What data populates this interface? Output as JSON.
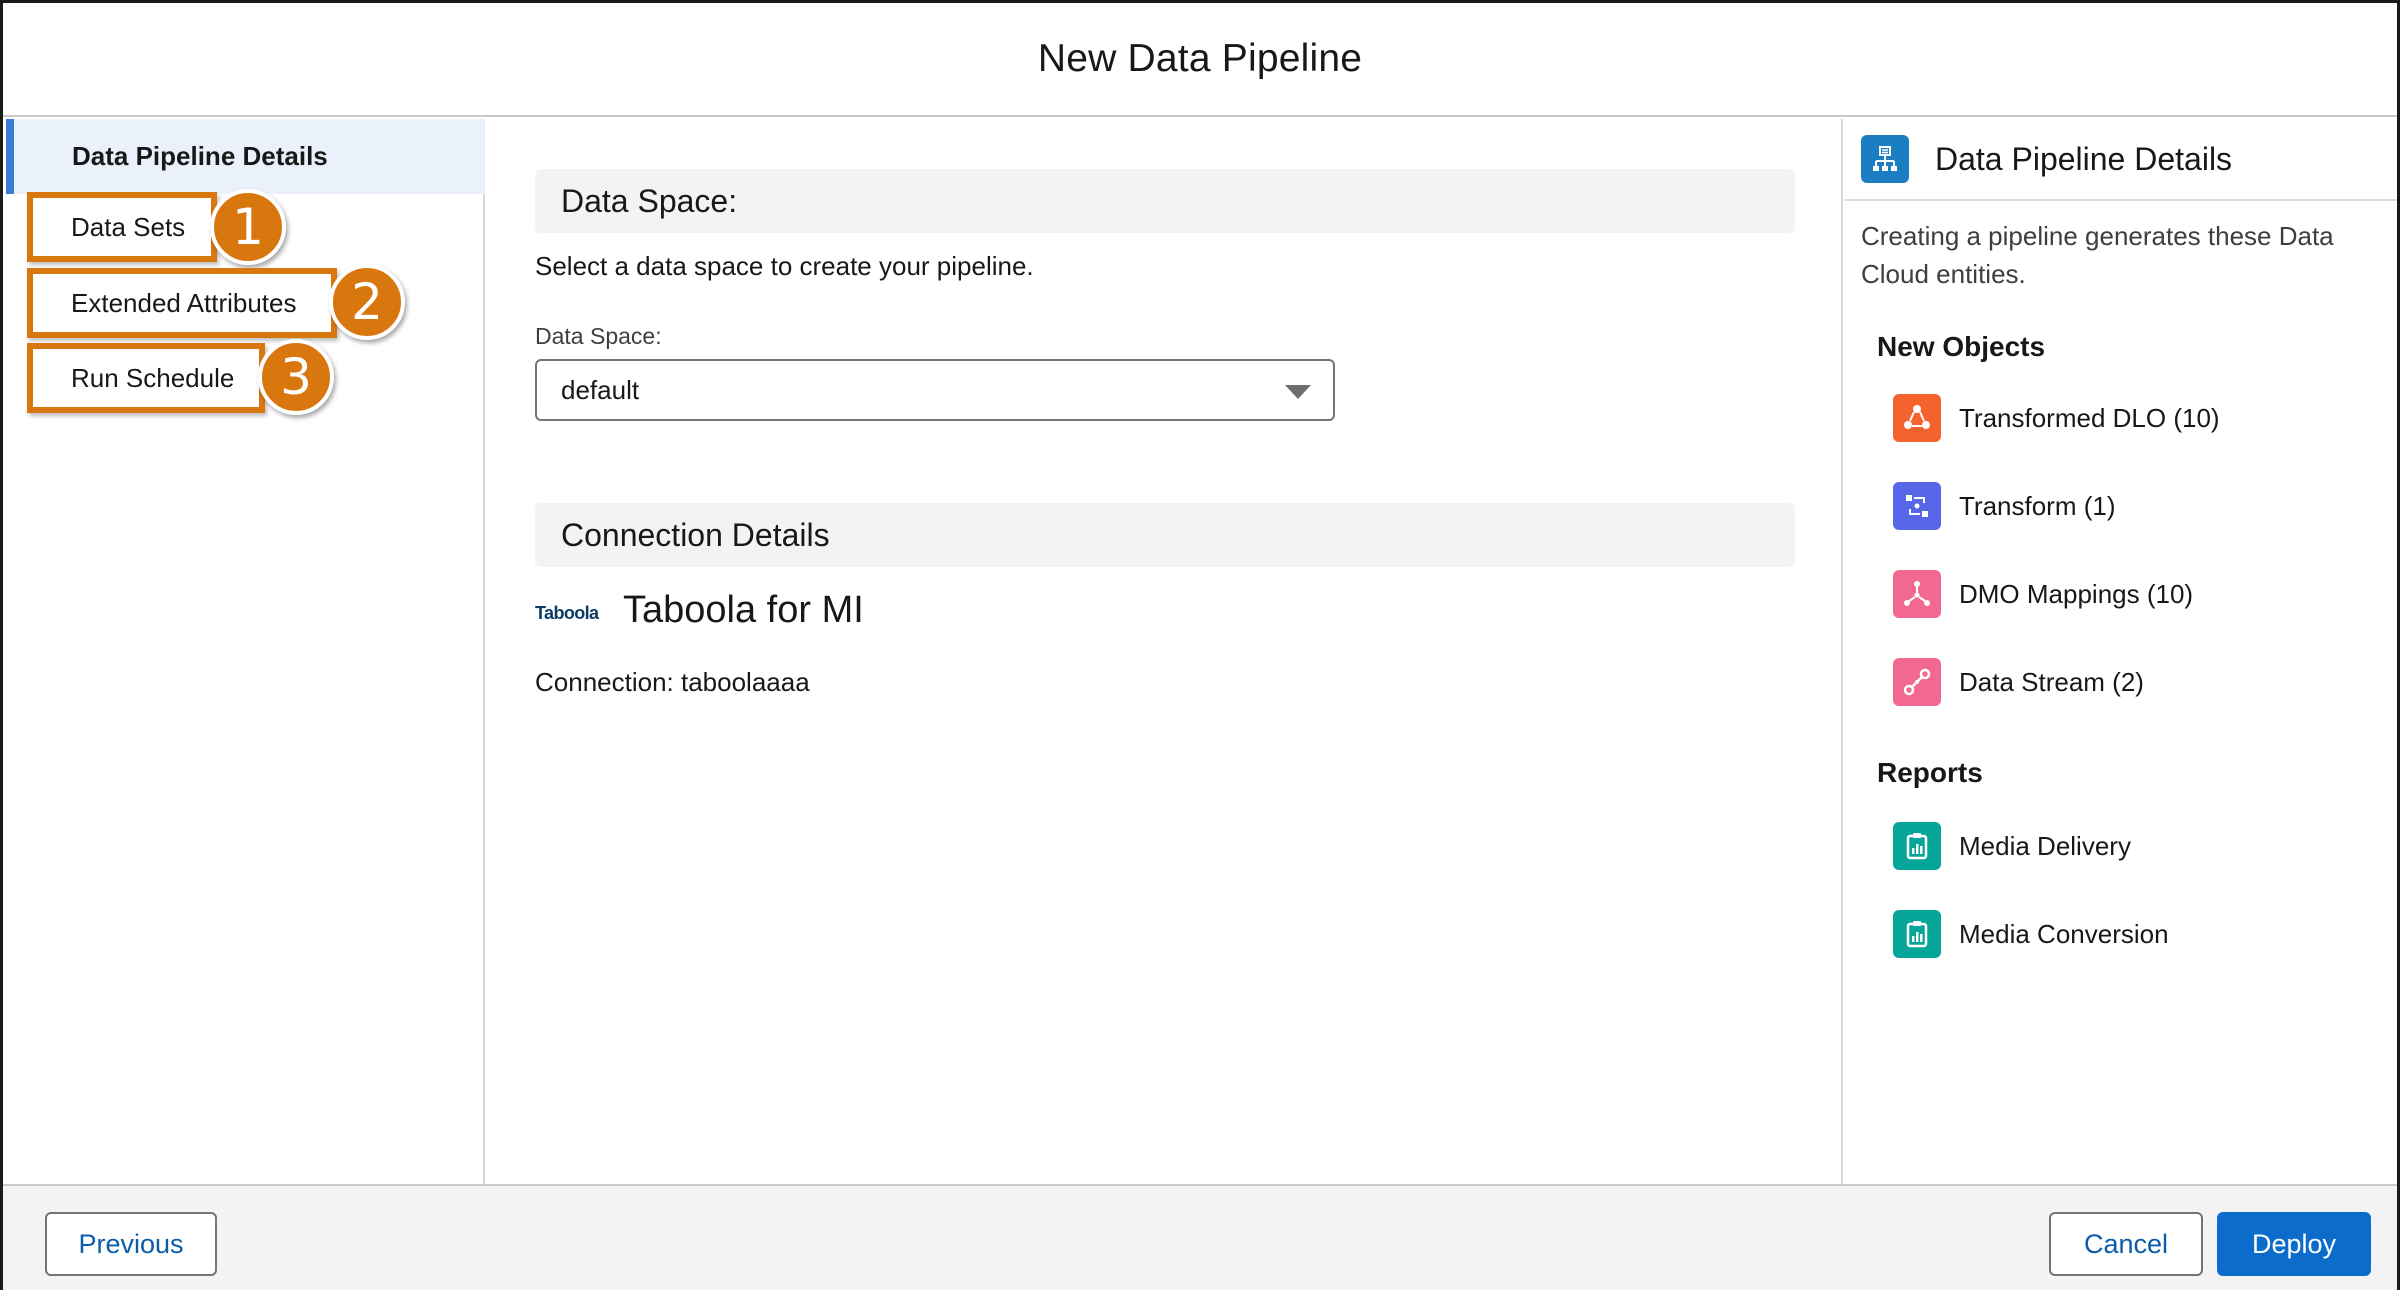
{
  "header": {
    "title": "New Data Pipeline"
  },
  "leftnav": {
    "active": "Data Pipeline Details",
    "items": [
      {
        "label": "Data Sets",
        "step": "1"
      },
      {
        "label": "Extended Attributes",
        "step": "2"
      },
      {
        "label": "Run Schedule",
        "step": "3"
      }
    ]
  },
  "main": {
    "data_space_heading": "Data Space:",
    "data_space_desc": "Select a data space to create your pipeline.",
    "data_space_label": "Data Space:",
    "data_space_value": "default",
    "connection_heading": "Connection Details",
    "connector_logo": "Taboola",
    "connector_name": "Taboola for MI",
    "connection_line": "Connection: taboolaaaa"
  },
  "rightpanel": {
    "title": "Data Pipeline Details",
    "description": "Creating a pipeline generates these Data Cloud entities.",
    "new_objects_title": "New Objects",
    "new_objects": [
      {
        "label": "Transformed DLO (10)",
        "icon": "transformed-dlo-icon",
        "color": "#f4622e"
      },
      {
        "label": "Transform (1)",
        "icon": "transform-icon",
        "color": "#5867e8"
      },
      {
        "label": "DMO Mappings (10)",
        "icon": "dmo-mappings-icon",
        "color": "#f26891"
      },
      {
        "label": "Data Stream (2)",
        "icon": "data-stream-icon",
        "color": "#f26891"
      }
    ],
    "reports_title": "Reports",
    "reports": [
      {
        "label": "Media Delivery",
        "icon": "report-icon",
        "color": "#06a59a"
      },
      {
        "label": "Media Conversion",
        "icon": "report-icon",
        "color": "#06a59a"
      }
    ]
  },
  "footer": {
    "previous_label": "Previous",
    "cancel_label": "Cancel",
    "deploy_label": "Deploy"
  },
  "colors": {
    "accent": "#d9770f",
    "brand": "#0b6ccb",
    "active_nav_bg": "#eaf1fb",
    "active_nav_bar": "#3a7bd5"
  }
}
